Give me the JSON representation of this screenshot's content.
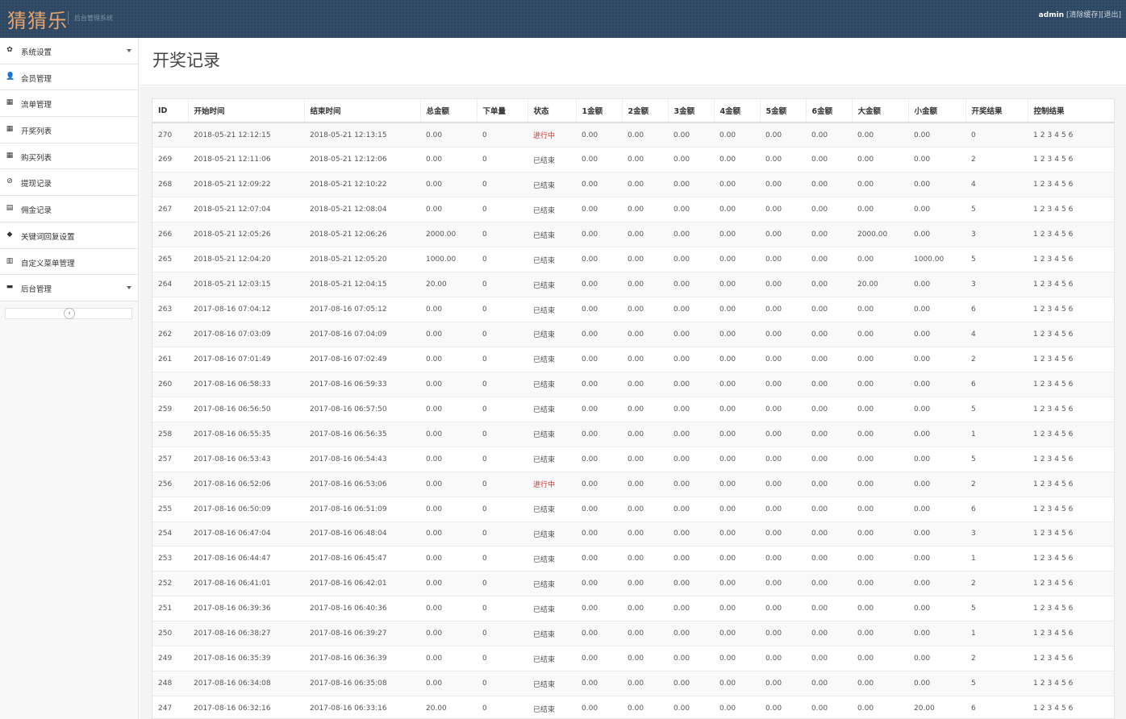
{
  "header": {
    "brand": "猜猜乐",
    "subtitle": "后台管理系统",
    "user": "admin",
    "clear_cache": "[清除缓存]",
    "logout": "[退出]"
  },
  "sidebar": {
    "items": [
      {
        "label": "系统设置",
        "icon": "gear-icon",
        "glyph": "✿",
        "caret": true
      },
      {
        "label": "会员管理",
        "icon": "user-icon",
        "glyph": "👤",
        "caret": false
      },
      {
        "label": "流单管理",
        "icon": "list-icon",
        "glyph": "▦",
        "caret": false
      },
      {
        "label": "开奖列表",
        "icon": "list-icon",
        "glyph": "▦",
        "caret": false
      },
      {
        "label": "购买列表",
        "icon": "list-icon",
        "glyph": "▦",
        "caret": false
      },
      {
        "label": "提现记录",
        "icon": "ban-icon",
        "glyph": "⊘",
        "caret": false
      },
      {
        "label": "佣金记录",
        "icon": "book-icon",
        "glyph": "▤",
        "caret": false
      },
      {
        "label": "关键词回复设置",
        "icon": "tags-icon",
        "glyph": "◆",
        "caret": false
      },
      {
        "label": "自定义菜单管理",
        "icon": "bar-chart-icon",
        "glyph": "▥",
        "caret": false
      },
      {
        "label": "后台管理",
        "icon": "comment-icon",
        "glyph": "▬",
        "caret": true
      }
    ],
    "collapse_glyph": "‹"
  },
  "page": {
    "title": "开奖记录"
  },
  "table": {
    "headers": [
      "ID",
      "开始时间",
      "结束时间",
      "总金额",
      "下单量",
      "状态",
      "1金额",
      "2金额",
      "3金额",
      "4金额",
      "5金额",
      "6金额",
      "大金额",
      "小金额",
      "开奖结果",
      "控制结果"
    ],
    "control_links": [
      "1",
      "2",
      "3",
      "4",
      "5",
      "6"
    ],
    "rows": [
      [
        "270",
        "2018-05-21 12:12:15",
        "2018-05-21 12:13:15",
        "0.00",
        "0",
        "进行中",
        "0.00",
        "0.00",
        "0.00",
        "0.00",
        "0.00",
        "0.00",
        "0.00",
        "0.00",
        "0"
      ],
      [
        "269",
        "2018-05-21 12:11:06",
        "2018-05-21 12:12:06",
        "0.00",
        "0",
        "已结束",
        "0.00",
        "0.00",
        "0.00",
        "0.00",
        "0.00",
        "0.00",
        "0.00",
        "0.00",
        "2"
      ],
      [
        "268",
        "2018-05-21 12:09:22",
        "2018-05-21 12:10:22",
        "0.00",
        "0",
        "已结束",
        "0.00",
        "0.00",
        "0.00",
        "0.00",
        "0.00",
        "0.00",
        "0.00",
        "0.00",
        "4"
      ],
      [
        "267",
        "2018-05-21 12:07:04",
        "2018-05-21 12:08:04",
        "0.00",
        "0",
        "已结束",
        "0.00",
        "0.00",
        "0.00",
        "0.00",
        "0.00",
        "0.00",
        "0.00",
        "0.00",
        "5"
      ],
      [
        "266",
        "2018-05-21 12:05:26",
        "2018-05-21 12:06:26",
        "2000.00",
        "0",
        "已结束",
        "0.00",
        "0.00",
        "0.00",
        "0.00",
        "0.00",
        "0.00",
        "2000.00",
        "0.00",
        "3"
      ],
      [
        "265",
        "2018-05-21 12:04:20",
        "2018-05-21 12:05:20",
        "1000.00",
        "0",
        "已结束",
        "0.00",
        "0.00",
        "0.00",
        "0.00",
        "0.00",
        "0.00",
        "0.00",
        "1000.00",
        "5"
      ],
      [
        "264",
        "2018-05-21 12:03:15",
        "2018-05-21 12:04:15",
        "20.00",
        "0",
        "已结束",
        "0.00",
        "0.00",
        "0.00",
        "0.00",
        "0.00",
        "0.00",
        "20.00",
        "0.00",
        "3"
      ],
      [
        "263",
        "2017-08-16 07:04:12",
        "2017-08-16 07:05:12",
        "0.00",
        "0",
        "已结束",
        "0.00",
        "0.00",
        "0.00",
        "0.00",
        "0.00",
        "0.00",
        "0.00",
        "0.00",
        "6"
      ],
      [
        "262",
        "2017-08-16 07:03:09",
        "2017-08-16 07:04:09",
        "0.00",
        "0",
        "已结束",
        "0.00",
        "0.00",
        "0.00",
        "0.00",
        "0.00",
        "0.00",
        "0.00",
        "0.00",
        "4"
      ],
      [
        "261",
        "2017-08-16 07:01:49",
        "2017-08-16 07:02:49",
        "0.00",
        "0",
        "已结束",
        "0.00",
        "0.00",
        "0.00",
        "0.00",
        "0.00",
        "0.00",
        "0.00",
        "0.00",
        "2"
      ],
      [
        "260",
        "2017-08-16 06:58:33",
        "2017-08-16 06:59:33",
        "0.00",
        "0",
        "已结束",
        "0.00",
        "0.00",
        "0.00",
        "0.00",
        "0.00",
        "0.00",
        "0.00",
        "0.00",
        "6"
      ],
      [
        "259",
        "2017-08-16 06:56:50",
        "2017-08-16 06:57:50",
        "0.00",
        "0",
        "已结束",
        "0.00",
        "0.00",
        "0.00",
        "0.00",
        "0.00",
        "0.00",
        "0.00",
        "0.00",
        "5"
      ],
      [
        "258",
        "2017-08-16 06:55:35",
        "2017-08-16 06:56:35",
        "0.00",
        "0",
        "已结束",
        "0.00",
        "0.00",
        "0.00",
        "0.00",
        "0.00",
        "0.00",
        "0.00",
        "0.00",
        "1"
      ],
      [
        "257",
        "2017-08-16 06:53:43",
        "2017-08-16 06:54:43",
        "0.00",
        "0",
        "已结束",
        "0.00",
        "0.00",
        "0.00",
        "0.00",
        "0.00",
        "0.00",
        "0.00",
        "0.00",
        "5"
      ],
      [
        "256",
        "2017-08-16 06:52:06",
        "2017-08-16 06:53:06",
        "0.00",
        "0",
        "进行中",
        "0.00",
        "0.00",
        "0.00",
        "0.00",
        "0.00",
        "0.00",
        "0.00",
        "0.00",
        "2"
      ],
      [
        "255",
        "2017-08-16 06:50:09",
        "2017-08-16 06:51:09",
        "0.00",
        "0",
        "已结束",
        "0.00",
        "0.00",
        "0.00",
        "0.00",
        "0.00",
        "0.00",
        "0.00",
        "0.00",
        "6"
      ],
      [
        "254",
        "2017-08-16 06:47:04",
        "2017-08-16 06:48:04",
        "0.00",
        "0",
        "已结束",
        "0.00",
        "0.00",
        "0.00",
        "0.00",
        "0.00",
        "0.00",
        "0.00",
        "0.00",
        "3"
      ],
      [
        "253",
        "2017-08-16 06:44:47",
        "2017-08-16 06:45:47",
        "0.00",
        "0",
        "已结束",
        "0.00",
        "0.00",
        "0.00",
        "0.00",
        "0.00",
        "0.00",
        "0.00",
        "0.00",
        "1"
      ],
      [
        "252",
        "2017-08-16 06:41:01",
        "2017-08-16 06:42:01",
        "0.00",
        "0",
        "已结束",
        "0.00",
        "0.00",
        "0.00",
        "0.00",
        "0.00",
        "0.00",
        "0.00",
        "0.00",
        "2"
      ],
      [
        "251",
        "2017-08-16 06:39:36",
        "2017-08-16 06:40:36",
        "0.00",
        "0",
        "已结束",
        "0.00",
        "0.00",
        "0.00",
        "0.00",
        "0.00",
        "0.00",
        "0.00",
        "0.00",
        "5"
      ],
      [
        "250",
        "2017-08-16 06:38:27",
        "2017-08-16 06:39:27",
        "0.00",
        "0",
        "已结束",
        "0.00",
        "0.00",
        "0.00",
        "0.00",
        "0.00",
        "0.00",
        "0.00",
        "0.00",
        "1"
      ],
      [
        "249",
        "2017-08-16 06:35:39",
        "2017-08-16 06:36:39",
        "0.00",
        "0",
        "已结束",
        "0.00",
        "0.00",
        "0.00",
        "0.00",
        "0.00",
        "0.00",
        "0.00",
        "0.00",
        "2"
      ],
      [
        "248",
        "2017-08-16 06:34:08",
        "2017-08-16 06:35:08",
        "0.00",
        "0",
        "已结束",
        "0.00",
        "0.00",
        "0.00",
        "0.00",
        "0.00",
        "0.00",
        "0.00",
        "0.00",
        "5"
      ],
      [
        "247",
        "2017-08-16 06:32:16",
        "2017-08-16 06:33:16",
        "20.00",
        "0",
        "已结束",
        "0.00",
        "0.00",
        "0.00",
        "0.00",
        "0.00",
        "0.00",
        "0.00",
        "20.00",
        "6"
      ]
    ]
  },
  "colors": {
    "topbar": "#2f4863",
    "brand": "#e8a46a",
    "status_running": "#c9302c"
  }
}
